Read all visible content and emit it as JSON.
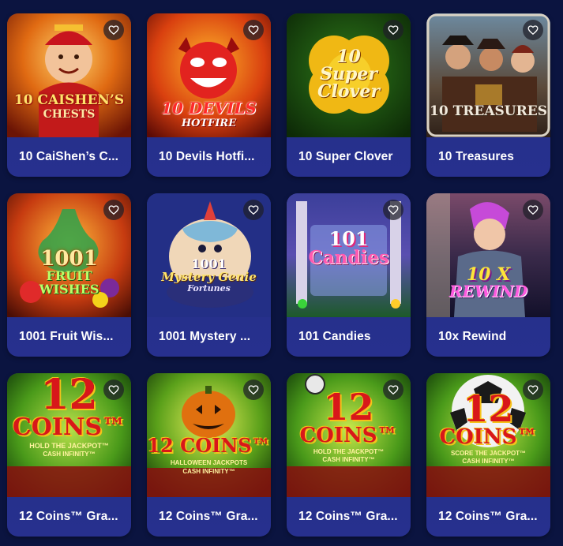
{
  "games": [
    {
      "title": "10 CaiShen’s C...",
      "art_lines": [
        "10 CAISHEN’S",
        "CHESTS"
      ]
    },
    {
      "title": "10 Devils Hotfi...",
      "art_lines": [
        "10 DEVILS",
        "HOTFIRE"
      ]
    },
    {
      "title": "10 Super Clover",
      "art_lines": [
        "10",
        "Super",
        "Clover"
      ]
    },
    {
      "title": "10 Treasures",
      "art_lines": [
        "10 TREASURES"
      ]
    },
    {
      "title": "1001 Fruit Wis...",
      "art_lines": [
        "1001",
        "FRUIT",
        "WISHES"
      ]
    },
    {
      "title": "1001 Mystery ...",
      "art_lines": [
        "1001",
        "Mystery Genie",
        "Fortunes"
      ]
    },
    {
      "title": "101 Candies",
      "art_lines": [
        "101",
        "Candies"
      ]
    },
    {
      "title": "10x Rewind",
      "art_lines": [
        "10 X",
        "REWIND"
      ]
    },
    {
      "title": "12 Coins™ Gra...",
      "art_lines": [
        "12",
        "COINS™",
        "HOLD THE JACKPOT™",
        "CASH INFINITY™"
      ]
    },
    {
      "title": "12 Coins™ Gra...",
      "art_lines": [
        "12 COINS™",
        "HALLOWEEN JACKPOTS",
        "CASH INFINITY™"
      ]
    },
    {
      "title": "12 Coins™ Gra...",
      "art_lines": [
        "12",
        "COINS™",
        "HOLD THE JACKPOT™",
        "CASH INFINITY™"
      ]
    },
    {
      "title": "12 Coins™ Gra...",
      "art_lines": [
        "12",
        "COINS™",
        "SCORE THE JACKPOT™",
        "CASH INFINITY™"
      ]
    }
  ],
  "icons": {
    "favorite": "heart-outline-icon"
  },
  "colors": {
    "page_bg": "#0b1440",
    "card_bg": "#252f8a",
    "text": "#ffffff"
  }
}
